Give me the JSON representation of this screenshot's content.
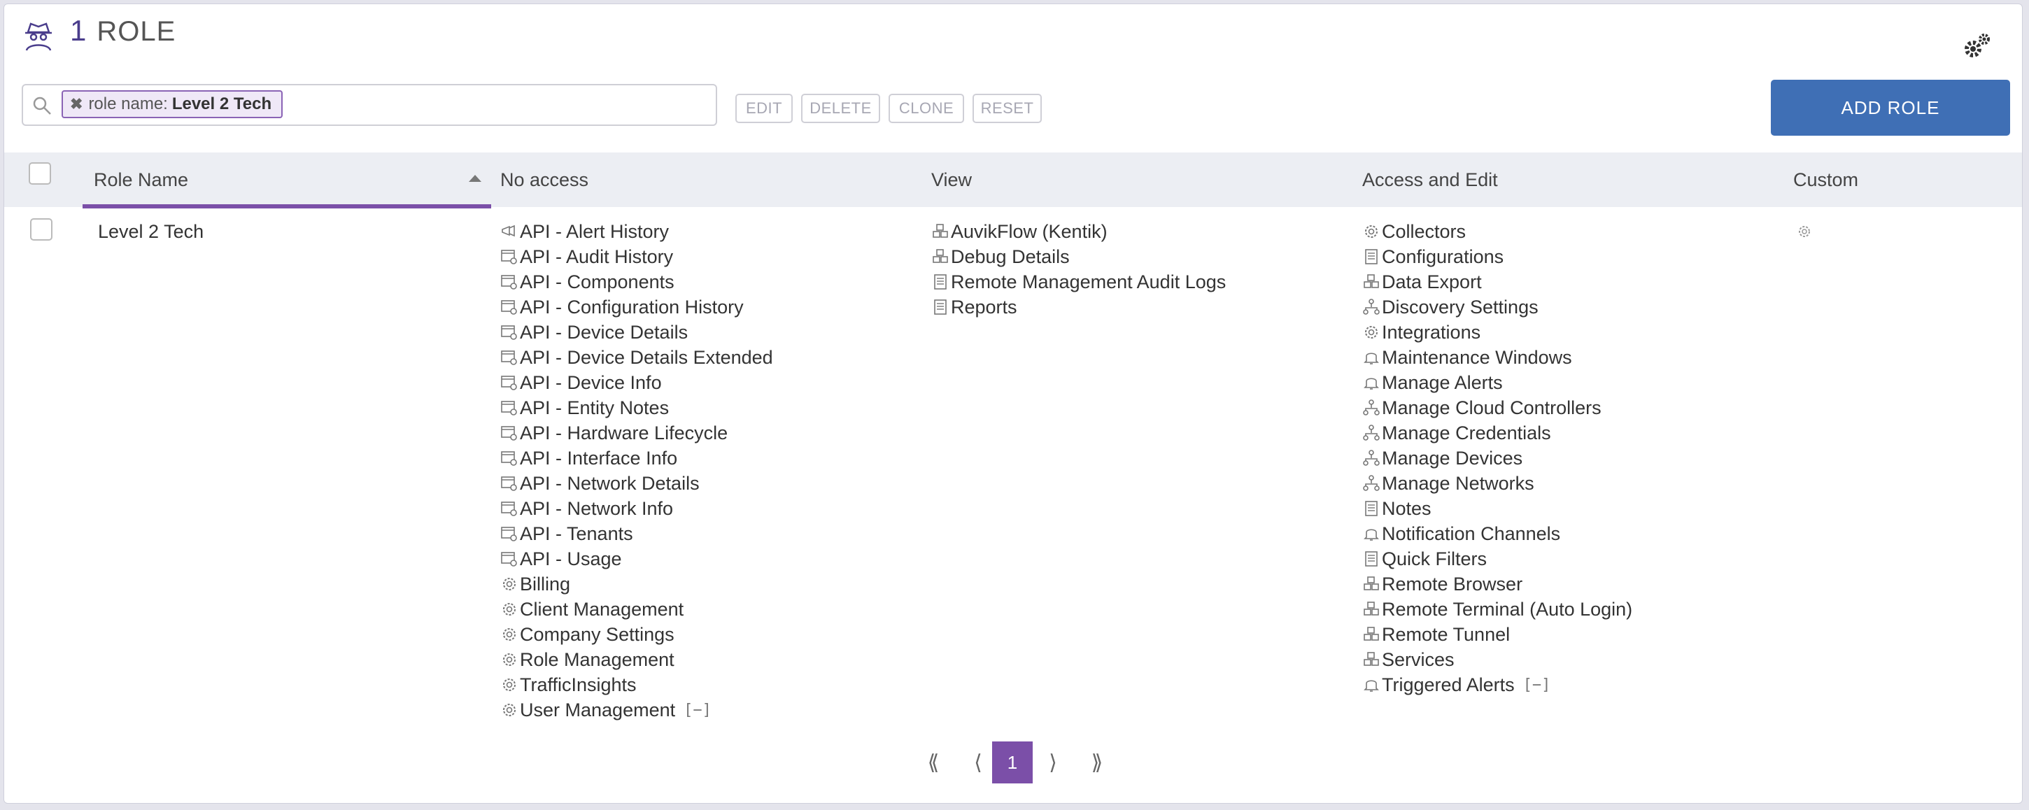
{
  "header": {
    "count": "1",
    "title": "ROLE"
  },
  "search": {
    "filter_key": "role name:",
    "filter_value": "Level 2 Tech",
    "remove_icon": "x-icon"
  },
  "toolbar": {
    "edit": "EDIT",
    "delete": "DELETE",
    "clone": "CLONE",
    "reset": "RESET",
    "add_role": "ADD ROLE"
  },
  "colors": {
    "accent": "#7b4fa8",
    "primary_button": "#3f6fb5",
    "header_bg": "#eceef3"
  },
  "table": {
    "columns": [
      "Role Name",
      "No access",
      "View",
      "Access and Edit",
      "Custom"
    ],
    "sort": {
      "column": "Role Name",
      "direction": "ascending"
    },
    "rows": [
      {
        "role_name": "Level 2 Tech",
        "no_access": [
          {
            "icon": "api",
            "label": "API - Alert History"
          },
          {
            "icon": "api-window",
            "label": "API - Audit History"
          },
          {
            "icon": "api-window",
            "label": "API - Components"
          },
          {
            "icon": "api-window",
            "label": "API - Configuration History"
          },
          {
            "icon": "api-window",
            "label": "API - Device Details"
          },
          {
            "icon": "api-window",
            "label": "API - Device Details Extended"
          },
          {
            "icon": "api-window",
            "label": "API - Device Info"
          },
          {
            "icon": "api-window",
            "label": "API - Entity Notes"
          },
          {
            "icon": "api-window",
            "label": "API - Hardware Lifecycle"
          },
          {
            "icon": "api-window",
            "label": "API - Interface Info"
          },
          {
            "icon": "api-window",
            "label": "API - Network Details"
          },
          {
            "icon": "api-window",
            "label": "API - Network Info"
          },
          {
            "icon": "api-window",
            "label": "API - Tenants"
          },
          {
            "icon": "api-window",
            "label": "API - Usage"
          },
          {
            "icon": "gear",
            "label": "Billing"
          },
          {
            "icon": "gear",
            "label": "Client Management"
          },
          {
            "icon": "gear",
            "label": "Company Settings"
          },
          {
            "icon": "gear",
            "label": "Role Management"
          },
          {
            "icon": "gear",
            "label": "TrafficInsights"
          },
          {
            "icon": "gear",
            "label": "User Management",
            "toggle": "[−]"
          }
        ],
        "view": [
          {
            "icon": "cubes",
            "label": "AuvikFlow (Kentik)"
          },
          {
            "icon": "cubes",
            "label": "Debug Details"
          },
          {
            "icon": "document",
            "label": "Remote Management Audit Logs"
          },
          {
            "icon": "document",
            "label": "Reports"
          }
        ],
        "access_and_edit": [
          {
            "icon": "gear",
            "label": "Collectors"
          },
          {
            "icon": "document",
            "label": "Configurations"
          },
          {
            "icon": "cubes",
            "label": "Data Export"
          },
          {
            "icon": "network",
            "label": "Discovery Settings"
          },
          {
            "icon": "gear",
            "label": "Integrations"
          },
          {
            "icon": "bell",
            "label": "Maintenance Windows"
          },
          {
            "icon": "bell",
            "label": "Manage Alerts"
          },
          {
            "icon": "network",
            "label": "Manage Cloud Controllers"
          },
          {
            "icon": "network",
            "label": "Manage Credentials"
          },
          {
            "icon": "network",
            "label": "Manage Devices"
          },
          {
            "icon": "network",
            "label": "Manage Networks"
          },
          {
            "icon": "document",
            "label": "Notes"
          },
          {
            "icon": "bell",
            "label": "Notification Channels"
          },
          {
            "icon": "document",
            "label": "Quick Filters"
          },
          {
            "icon": "cubes",
            "label": "Remote Browser"
          },
          {
            "icon": "cubes",
            "label": "Remote Terminal (Auto Login)"
          },
          {
            "icon": "cubes",
            "label": "Remote Tunnel"
          },
          {
            "icon": "cubes",
            "label": "Services"
          },
          {
            "icon": "bell",
            "label": "Triggered Alerts",
            "toggle": "[−]"
          }
        ],
        "custom_icon": "gear"
      }
    ]
  },
  "pagination": {
    "first": "⟪",
    "prev": "⟨",
    "current": "1",
    "next": "⟩",
    "last": "⟫"
  }
}
